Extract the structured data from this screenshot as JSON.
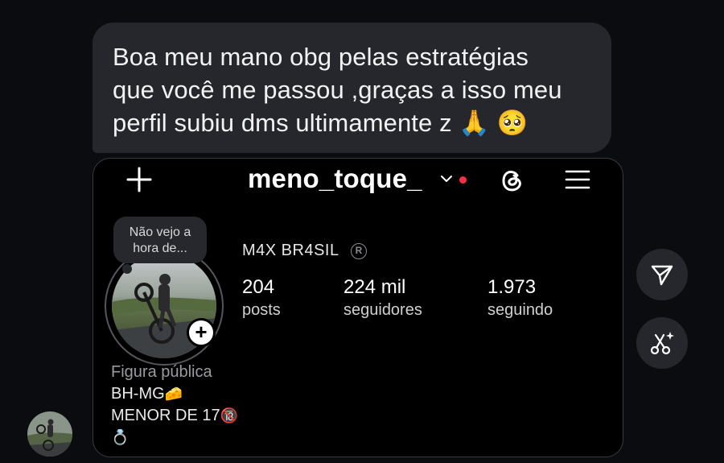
{
  "message": {
    "line1": "Boa meu mano obg pelas estratégias",
    "line2": "que você me passou ,graças a isso meu",
    "line3": "perfil subiu dms ultimamente z",
    "emoji1": "🙏",
    "emoji2": "🥺"
  },
  "profile": {
    "username": "meno_toque_",
    "note": "Não vejo a hora de...",
    "display_name": "M4X BR4SIL",
    "stats": [
      {
        "value": "204",
        "label": "posts"
      },
      {
        "value": "224 mil",
        "label": "seguidores"
      },
      {
        "value": "1.973",
        "label": "seguindo"
      }
    ],
    "bio": {
      "category": "Figura pública",
      "line1": "BH-MG",
      "line1_emoji": "🧀",
      "line2": "MENOR DE 17",
      "line2_emoji": "🔞",
      "line3_emoji": "💍"
    }
  },
  "icons": {
    "header": [
      "plus-icon",
      "chevron-down-icon",
      "threads-icon",
      "menu-icon"
    ],
    "side": [
      "send-icon",
      "ai-edit-icon"
    ]
  },
  "colors": {
    "background": "#0b0c10",
    "bubble": "#26272c",
    "notification_dot": "#ff3040"
  }
}
